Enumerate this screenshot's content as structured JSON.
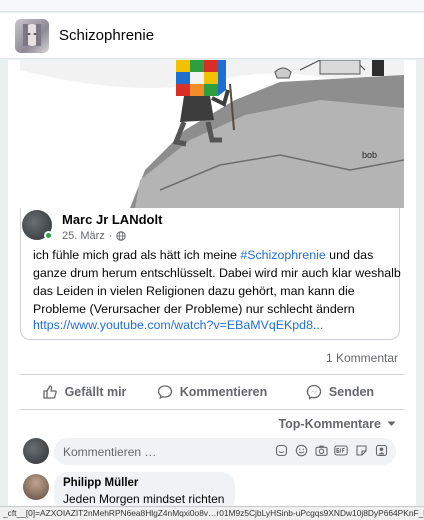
{
  "group": {
    "title": "Schizophrenie"
  },
  "post": {
    "author": "Marc Jr LANdolt",
    "date": "25. März",
    "dot": "·",
    "text_before": "ich fühle mich grad als hätt ich meine ",
    "hashtag": "#Schizophrenie",
    "text_after": " und das ganze drum herum entschlüsselt. Dabei wird mir auch klar weshalb das Leiden in vielen Religionen dazu gehört, man kann die Probleme (Verursacher der Probleme) nur schlecht ändern",
    "link": "https://www.youtube.com/watch?v=EBaMVqEKpd8...",
    "signature": "bob"
  },
  "stats": {
    "comments": "1 Kommentar"
  },
  "actions": {
    "like": "Gefällt mir",
    "comment": "Kommentieren",
    "send": "Senden"
  },
  "comments_sort": "Top-Kommentare",
  "comment_box": {
    "placeholder": "Kommentieren …"
  },
  "comment": {
    "name": "Philipp Müller",
    "text": "Jeden Morgen mindset richten"
  },
  "statusbar": {
    "url": "_cft__[0]=AZXOIAZIT2nMehRPN6ea8HlgZ4nMqxi0o8v…r01M9z5CjbLyHSinb-uPcgqs9XNDw10j8DyP664PKnF_kn"
  },
  "icons": {
    "like": "thumbs-up-icon",
    "comment": "speech-bubble-icon",
    "send": "messenger-icon",
    "sort": "caret-down-icon",
    "globe": "globe-icon",
    "tools": [
      "sticker-icon",
      "emoji-icon",
      "camera-icon",
      "gif-icon",
      "sticker-face-icon",
      "avatar-sticker-icon"
    ]
  }
}
